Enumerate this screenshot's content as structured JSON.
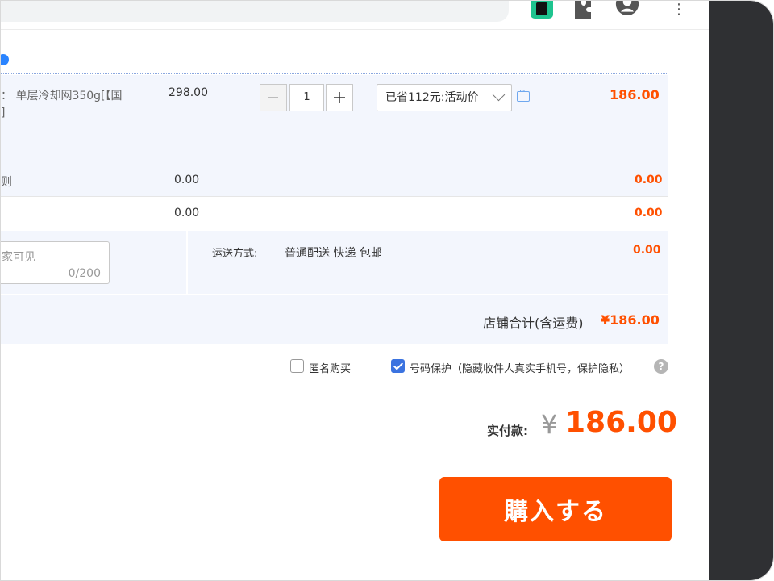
{
  "chrome": {
    "extensions": [
      "green-extension-icon",
      "puzzle-icon",
      "account-icon",
      "more-menu-icon"
    ],
    "menu_glyph": "⋮"
  },
  "item": {
    "title_line1": "：  单层冷却网350g[【国",
    "title_line2": "]",
    "unit_price": "298.00",
    "quantity": "1",
    "promo": "已省112元:活动价",
    "subtotal": "186.00"
  },
  "extra_rows": [
    {
      "label": "则",
      "price": "0.00",
      "subtotal": "0.00"
    },
    {
      "label": "",
      "price": "0.00",
      "subtotal": "0.00"
    }
  ],
  "shipping": {
    "memo_placeholder": "家可见",
    "memo_count": "0/200",
    "method_label": "运送方式:",
    "method_value": "普通配送 快递 包邮",
    "fee": "0.00"
  },
  "shop_total": {
    "label": "店铺合计(含运费)",
    "amount": "¥186.00"
  },
  "options": {
    "anonymous_label": "匿名购买",
    "anonymous_checked": false,
    "privacy_label": "号码保护（隐藏收件人真实手机号，保护隐私）",
    "privacy_checked": true
  },
  "payment": {
    "label": "实付款:",
    "currency": "¥",
    "amount": "186.00"
  },
  "buy_button": "購入する",
  "colors": {
    "accent": "#ff5000",
    "checkbox_blue": "#3b73e0",
    "row_bg": "#f3f6fd",
    "dark_panel": "#2f3033"
  }
}
